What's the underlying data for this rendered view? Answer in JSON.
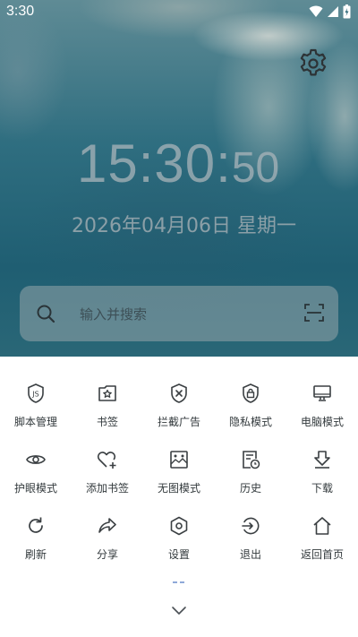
{
  "status_bar": {
    "time": "3:30"
  },
  "clock": {
    "hours_minutes": "15:30:",
    "seconds": "50"
  },
  "date": "2026年04月06日 星期一",
  "search": {
    "placeholder": "输入并搜索"
  },
  "menu": {
    "rows": [
      [
        {
          "label": "脚本管理",
          "icon": "script-icon"
        },
        {
          "label": "书签",
          "icon": "bookmark-star-icon"
        },
        {
          "label": "拦截广告",
          "icon": "ad-block-icon"
        },
        {
          "label": "隐私模式",
          "icon": "privacy-lock-icon"
        },
        {
          "label": "电脑模式",
          "icon": "desktop-icon"
        }
      ],
      [
        {
          "label": "护眼模式",
          "icon": "eye-icon"
        },
        {
          "label": "添加书签",
          "icon": "heart-plus-icon"
        },
        {
          "label": "无图模式",
          "icon": "image-icon"
        },
        {
          "label": "历史",
          "icon": "history-icon"
        },
        {
          "label": "下载",
          "icon": "download-icon"
        }
      ],
      [
        {
          "label": "刷新",
          "icon": "refresh-icon"
        },
        {
          "label": "分享",
          "icon": "share-icon"
        },
        {
          "label": "设置",
          "icon": "settings-hex-icon"
        },
        {
          "label": "退出",
          "icon": "exit-icon"
        },
        {
          "label": "返回首页",
          "icon": "home-icon"
        }
      ]
    ]
  },
  "colors": {
    "icon_stroke": "#3a3f42",
    "indicator": "#8fa9d8",
    "sheet_background": "#ffffff"
  }
}
